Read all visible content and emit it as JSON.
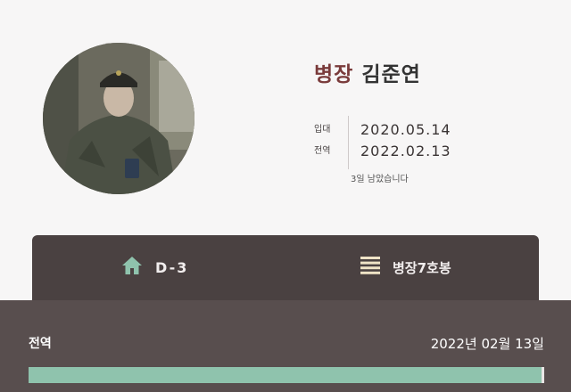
{
  "profile": {
    "rank": "병장",
    "name": "김준연"
  },
  "dates": {
    "enlist_label": "입대",
    "discharge_label": "전역",
    "enlist_date": "2020.05.14",
    "discharge_date": "2022.02.13"
  },
  "remaining_text": "3일 남았습니다",
  "tabs": {
    "left": {
      "icon": "home-icon",
      "label": "D-3"
    },
    "right": {
      "icon": "menu-icon",
      "label": "병장7호봉"
    }
  },
  "panel": {
    "label": "전역",
    "date": "2022년 02월 13일",
    "progress": 0.995
  },
  "colors": {
    "accent": "#8fc3ad",
    "dark": "#4a4141",
    "panel": "#584e4e",
    "rank": "#7a3b3b"
  }
}
